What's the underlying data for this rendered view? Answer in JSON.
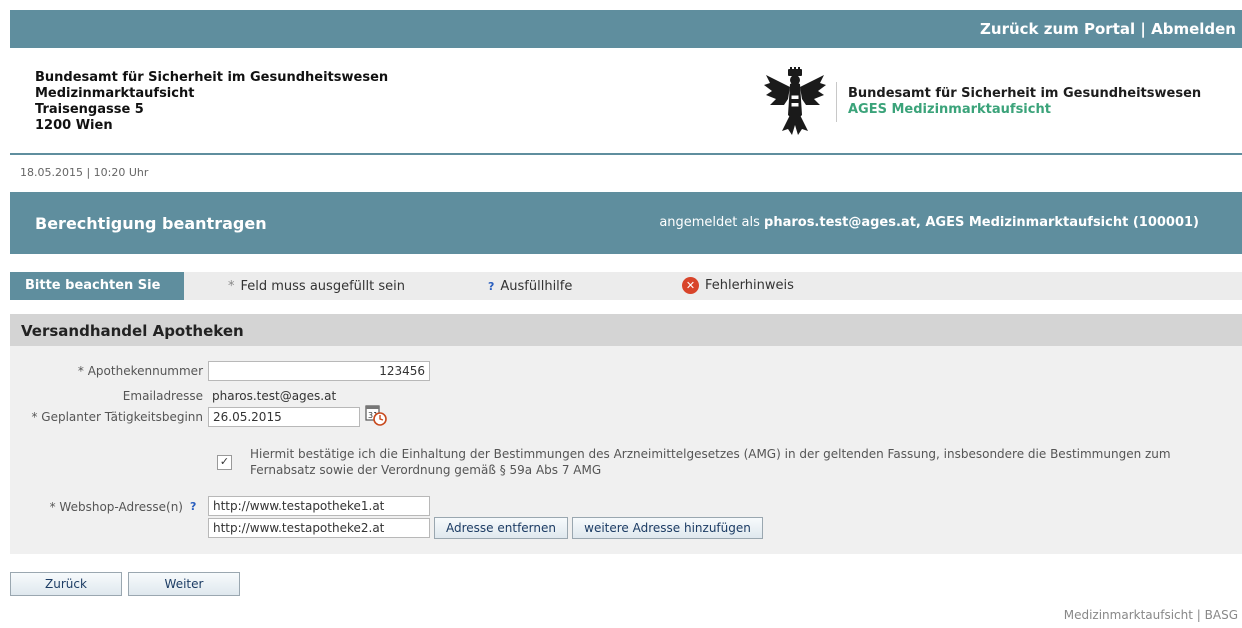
{
  "topbar": {
    "back_to_portal": "Zurück zum Portal",
    "separator": "|",
    "logout": "Abmelden"
  },
  "address": {
    "line1": "Bundesamt für Sicherheit im Gesundheitswesen",
    "line2": "Medizinmarktaufsicht",
    "line3": "Traisengasse 5",
    "line4": "1200 Wien"
  },
  "agency": {
    "name": "Bundesamt für Sicherheit im Gesundheitswesen",
    "subname": "AGES Medizinmarktaufsicht"
  },
  "datetime": "18.05.2015 | 10:20 Uhr",
  "titlebar": {
    "title": "Berechtigung beantragen",
    "logged_in_prefix": "angemeldet als",
    "logged_in_user": "pharos.test@ages.at, AGES Medizinmarktaufsicht (100001)"
  },
  "notice": {
    "label": "Bitte beachten Sie",
    "required_star": "*",
    "required_text": "Feld muss ausgefüllt sein",
    "help_mark": "?",
    "help_text": "Ausfüllhilfe",
    "error_text": "Fehlerhinweis"
  },
  "section": {
    "title": "Versandhandel Apotheken"
  },
  "form": {
    "pharmacy_label": "* Apothekennummer",
    "pharmacy_value": "123456",
    "email_label": "Emailadresse",
    "email_value": "pharos.test@ages.at",
    "start_label": "* Geplanter Tätigkeitsbeginn",
    "start_value": "26.05.2015",
    "confirm_checked": true,
    "confirm_text": "Hiermit bestätige ich die Einhaltung der Bestimmungen des Arzneimittelgesetzes (AMG) in der geltenden Fassung, insbesondere die Bestimmungen zum Fernabsatz sowie der Verordnung gemäß § 59a Abs 7 AMG",
    "webshop_label": "* Webshop-Adresse(n)",
    "webshop_help": "?",
    "webshop_1": "http://www.testapotheke1.at",
    "webshop_2": "http://www.testapotheke2.at",
    "remove_address": "Adresse entfernen",
    "add_address": "weitere Adresse hinzufügen"
  },
  "nav": {
    "back": "Zurück",
    "next": "Weiter"
  },
  "footer": "Medizinmarktaufsicht | BASG"
}
